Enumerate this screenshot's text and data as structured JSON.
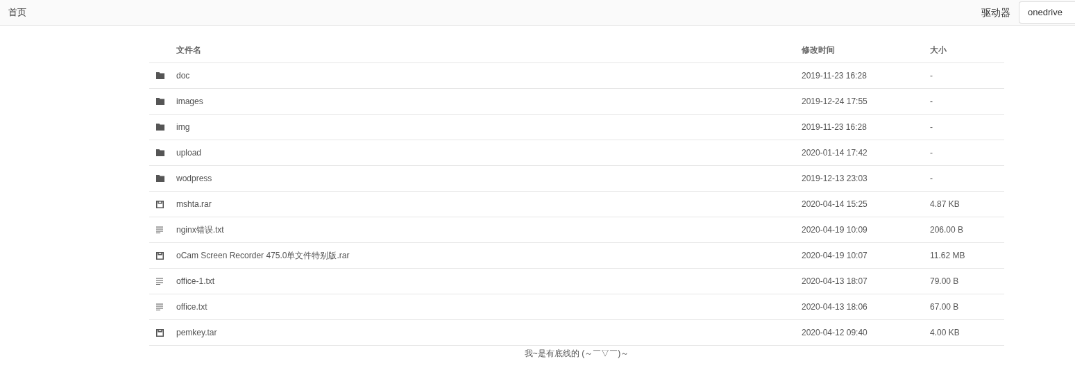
{
  "header": {
    "home_link": "首页",
    "drive_label": "驱动器",
    "drive_value": "onedrive"
  },
  "table": {
    "columns": [
      "文件名",
      "修改时间",
      "大小"
    ],
    "rows": [
      {
        "kind": "folder",
        "name": "doc",
        "modified": "2019-11-23 16:28",
        "size": "-"
      },
      {
        "kind": "folder",
        "name": "images",
        "modified": "2019-12-24 17:55",
        "size": "-"
      },
      {
        "kind": "folder",
        "name": "img",
        "modified": "2019-11-23 16:28",
        "size": "-"
      },
      {
        "kind": "folder",
        "name": "upload",
        "modified": "2020-01-14 17:42",
        "size": "-"
      },
      {
        "kind": "folder",
        "name": "wodpress",
        "modified": "2019-12-13 23:03",
        "size": "-"
      },
      {
        "kind": "archive",
        "name": "mshta.rar",
        "modified": "2020-04-14 15:25",
        "size": "4.87 KB"
      },
      {
        "kind": "text",
        "name": "nginx错误.txt",
        "modified": "2020-04-19 10:09",
        "size": "206.00 B"
      },
      {
        "kind": "archive",
        "name": "oCam Screen Recorder 475.0单文件特别版.rar",
        "modified": "2020-04-19 10:07",
        "size": "11.62 MB"
      },
      {
        "kind": "text",
        "name": "office-1.txt",
        "modified": "2020-04-13 18:07",
        "size": "79.00 B"
      },
      {
        "kind": "text",
        "name": "office.txt",
        "modified": "2020-04-13 18:06",
        "size": "67.00 B"
      },
      {
        "kind": "archive",
        "name": "pemkey.tar",
        "modified": "2020-04-12 09:40",
        "size": "4.00 KB"
      }
    ]
  },
  "footer": "我~是有底线的 (～￣▽￣)～"
}
